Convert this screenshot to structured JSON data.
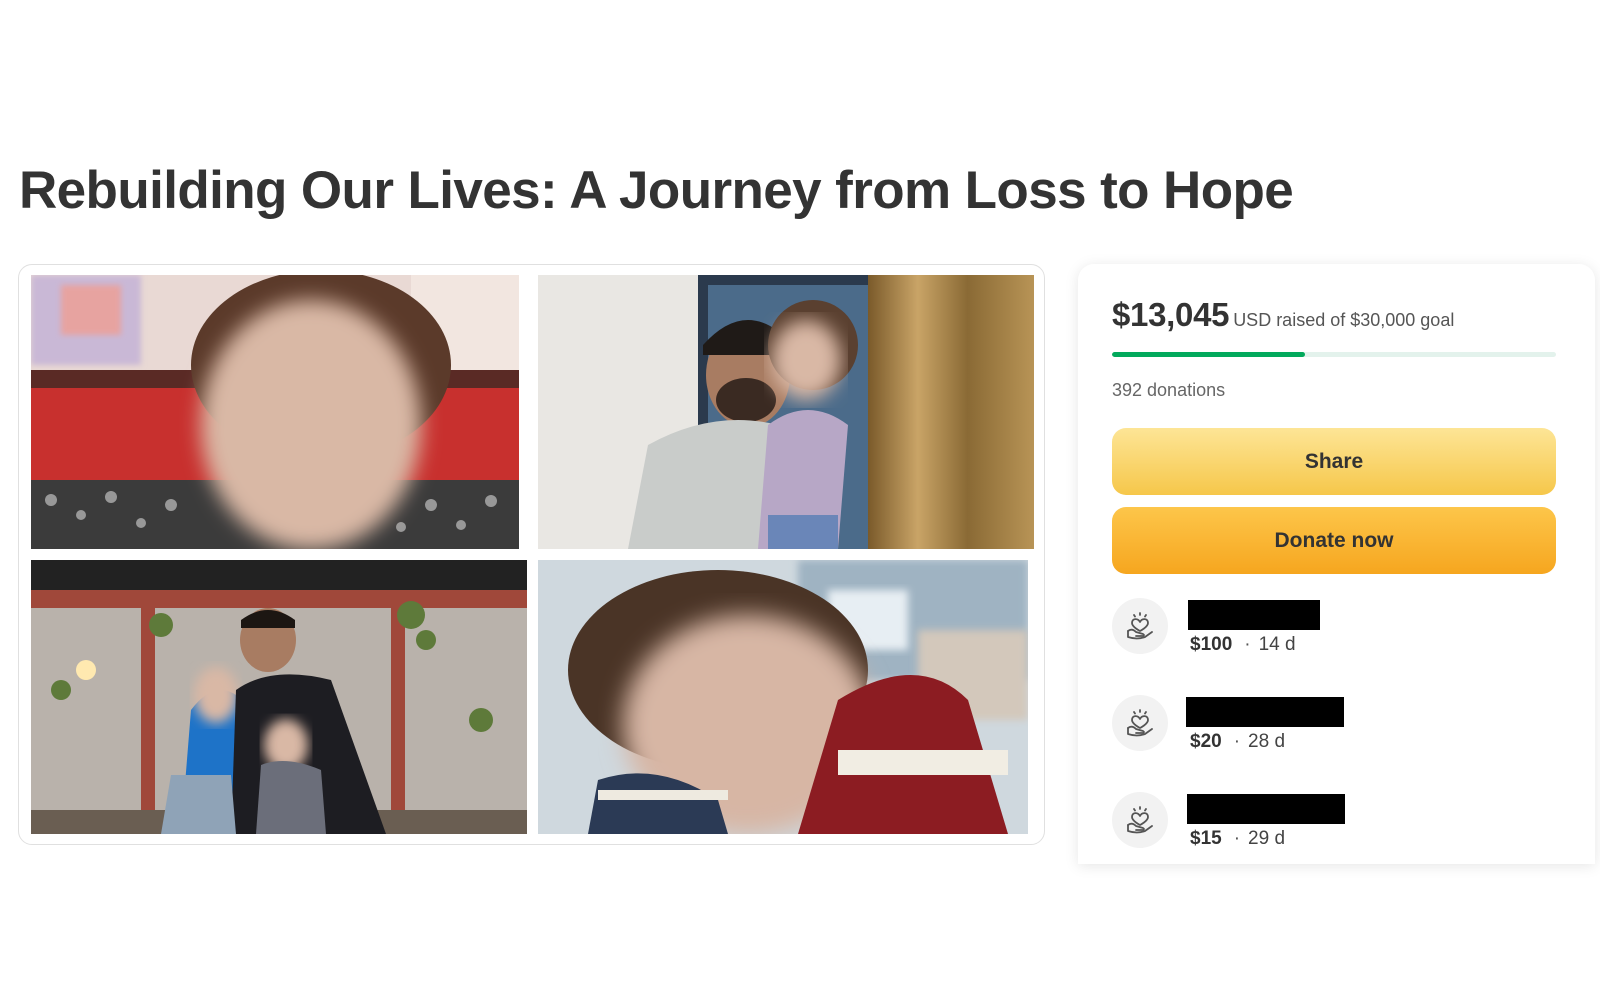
{
  "page": {
    "title": "Rebuilding Our Lives: A Journey from Loss to Hope"
  },
  "gallery": {
    "photos": [
      {
        "name": "child-portrait-photo"
      },
      {
        "name": "father-with-daughter-photo"
      },
      {
        "name": "family-group-photo"
      },
      {
        "name": "toddler-closeup-photo"
      }
    ]
  },
  "campaign": {
    "raised": "$13,045",
    "raised_suffix": "USD raised of $30,000 goal",
    "progress_fraction": 0.4348,
    "donations": "392 donations",
    "share_label": "Share",
    "donate_label": "Donate now",
    "colors": {
      "progress": "#02a95c",
      "track": "#e3f2ec",
      "share": "#f6c74a",
      "donate": "#f6a61f"
    }
  },
  "donors": [
    {
      "amount": "$100",
      "separator": "·",
      "time": "14 d",
      "icon": "heart-hand-icon"
    },
    {
      "amount": "$20",
      "separator": "·",
      "time": "28 d",
      "icon": "heart-hand-icon"
    },
    {
      "amount": "$15",
      "separator": "·",
      "time": "29 d",
      "icon": "heart-hand-icon"
    }
  ]
}
